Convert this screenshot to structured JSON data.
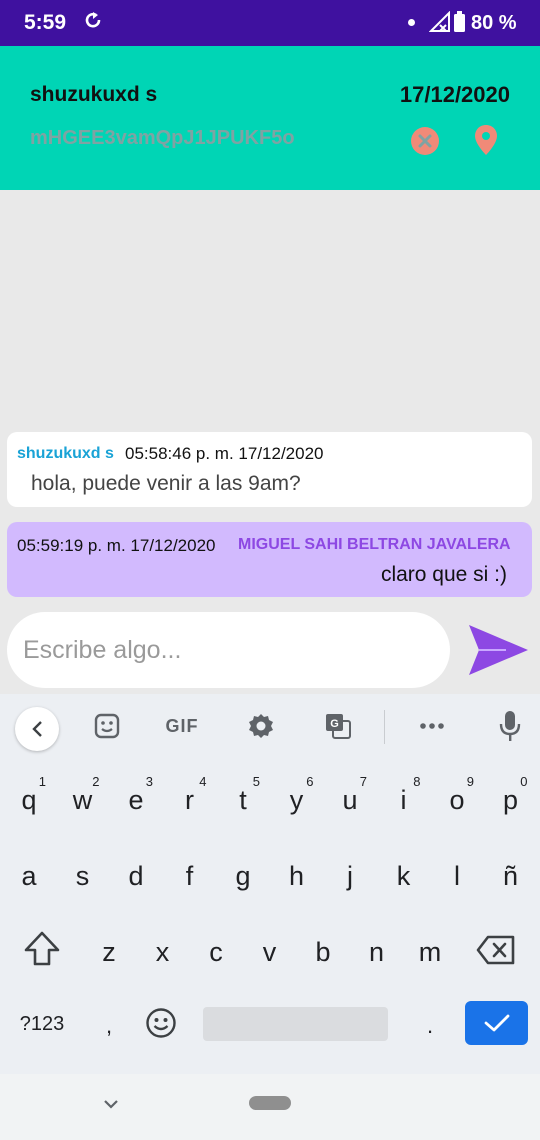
{
  "status_bar": {
    "time": "5:59",
    "battery": "80 %"
  },
  "header": {
    "name": "shuzukuxd s",
    "date": "17/12/2020",
    "conversation_id": "mHGEE3vamQpJ1JPUKF5o"
  },
  "messages": [
    {
      "sender": "shuzukuxd s",
      "time": "05:58:46 p. m. 17/12/2020",
      "text": "hola, puede venir a las 9am?",
      "direction": "incoming"
    },
    {
      "sender": "MIGUEL SAHI BELTRAN JAVALERA",
      "time": "05:59:19 p. m. 17/12/2020",
      "text": "claro que si :)",
      "direction": "outgoing"
    }
  ],
  "composer": {
    "placeholder": "Escribe algo..."
  },
  "keyboard": {
    "toolbar": {
      "gif_label": "GIF"
    },
    "row1": [
      {
        "key": "q",
        "hint": "1"
      },
      {
        "key": "w",
        "hint": "2"
      },
      {
        "key": "e",
        "hint": "3"
      },
      {
        "key": "r",
        "hint": "4"
      },
      {
        "key": "t",
        "hint": "5"
      },
      {
        "key": "y",
        "hint": "6"
      },
      {
        "key": "u",
        "hint": "7"
      },
      {
        "key": "i",
        "hint": "8"
      },
      {
        "key": "o",
        "hint": "9"
      },
      {
        "key": "p",
        "hint": "0"
      }
    ],
    "row2": [
      "a",
      "s",
      "d",
      "f",
      "g",
      "h",
      "j",
      "k",
      "l",
      "ñ"
    ],
    "row3": [
      "z",
      "x",
      "c",
      "v",
      "b",
      "n",
      "m"
    ],
    "symbols_label": "?123",
    "comma": ",",
    "period": "."
  },
  "colors": {
    "status_bar": "#3f119f",
    "header": "#00d5b5",
    "incoming_sender": "#1aa3d6",
    "outgoing_bubble": "#d2bafe",
    "outgoing_sender": "#8d48e3",
    "send_icon": "#8d48e3",
    "header_icons": "#f08a78",
    "enter_key": "#1a73e8"
  },
  "icons": [
    "sync-icon",
    "signal-icon",
    "battery-icon",
    "cancel-icon",
    "location-icon",
    "send-icon",
    "sticker-icon",
    "settings-icon",
    "translate-icon",
    "more-icon",
    "mic-icon",
    "shift-icon",
    "backspace-icon",
    "emoji-icon",
    "check-icon"
  ]
}
